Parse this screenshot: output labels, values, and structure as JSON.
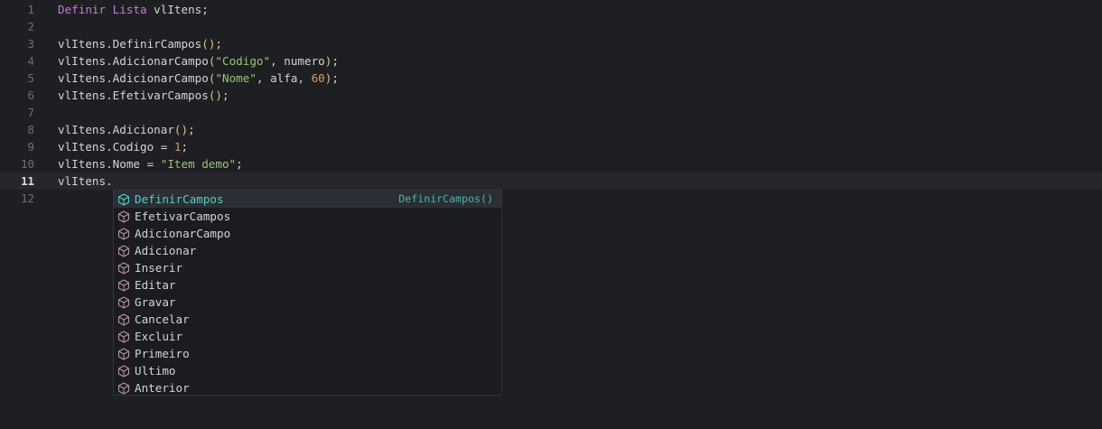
{
  "colors": {
    "background": "#1e1f22",
    "current_line": "#25272c",
    "keyword": "#c679dd",
    "string": "#98c379",
    "number": "#d19a66",
    "paren": "#e5c07b",
    "suggest_accent": "#4fd1c5",
    "suggest_icon": "#b48ead"
  },
  "editor": {
    "current_line_number": 11,
    "lines": [
      {
        "number": "1",
        "tokens": [
          {
            "t": "Definir",
            "k": "kw"
          },
          {
            "t": " ",
            "k": "plain"
          },
          {
            "t": "Lista",
            "k": "kw"
          },
          {
            "t": " vlItens;",
            "k": "plain"
          }
        ]
      },
      {
        "number": "2",
        "tokens": []
      },
      {
        "number": "3",
        "tokens": [
          {
            "t": "vlItens.DefinirCampos",
            "k": "plain"
          },
          {
            "t": "()",
            "k": "paren"
          },
          {
            "t": ";",
            "k": "plain"
          }
        ]
      },
      {
        "number": "4",
        "tokens": [
          {
            "t": "vlItens.AdicionarCampo",
            "k": "plain"
          },
          {
            "t": "(",
            "k": "paren"
          },
          {
            "t": "\"Codigo\"",
            "k": "str"
          },
          {
            "t": ", numero",
            "k": "plain"
          },
          {
            "t": ")",
            "k": "paren"
          },
          {
            "t": ";",
            "k": "plain"
          }
        ]
      },
      {
        "number": "5",
        "tokens": [
          {
            "t": "vlItens.AdicionarCampo",
            "k": "plain"
          },
          {
            "t": "(",
            "k": "paren"
          },
          {
            "t": "\"Nome\"",
            "k": "str"
          },
          {
            "t": ", alfa, ",
            "k": "plain"
          },
          {
            "t": "60",
            "k": "num"
          },
          {
            "t": ")",
            "k": "paren"
          },
          {
            "t": ";",
            "k": "plain"
          }
        ]
      },
      {
        "number": "6",
        "tokens": [
          {
            "t": "vlItens.EfetivarCampos",
            "k": "plain"
          },
          {
            "t": "()",
            "k": "paren"
          },
          {
            "t": ";",
            "k": "plain"
          }
        ]
      },
      {
        "number": "7",
        "tokens": []
      },
      {
        "number": "8",
        "tokens": [
          {
            "t": "vlItens.Adicionar",
            "k": "plain"
          },
          {
            "t": "()",
            "k": "paren"
          },
          {
            "t": ";",
            "k": "plain"
          }
        ]
      },
      {
        "number": "9",
        "tokens": [
          {
            "t": "vlItens.Codigo = ",
            "k": "plain"
          },
          {
            "t": "1",
            "k": "num"
          },
          {
            "t": ";",
            "k": "plain"
          }
        ]
      },
      {
        "number": "10",
        "tokens": [
          {
            "t": "vlItens.Nome = ",
            "k": "plain"
          },
          {
            "t": "\"Item demo\"",
            "k": "str"
          },
          {
            "t": ";",
            "k": "plain"
          }
        ]
      },
      {
        "number": "11",
        "tokens": [
          {
            "t": "vlItens.",
            "k": "plain"
          }
        ]
      },
      {
        "number": "12",
        "tokens": []
      }
    ]
  },
  "suggest": {
    "icon": "cube-icon",
    "selected_index": 0,
    "selected_detail": "DefinirCampos()",
    "items": [
      "DefinirCampos",
      "EfetivarCampos",
      "AdicionarCampo",
      "Adicionar",
      "Inserir",
      "Editar",
      "Gravar",
      "Cancelar",
      "Excluir",
      "Primeiro",
      "Ultimo",
      "Anterior"
    ]
  }
}
